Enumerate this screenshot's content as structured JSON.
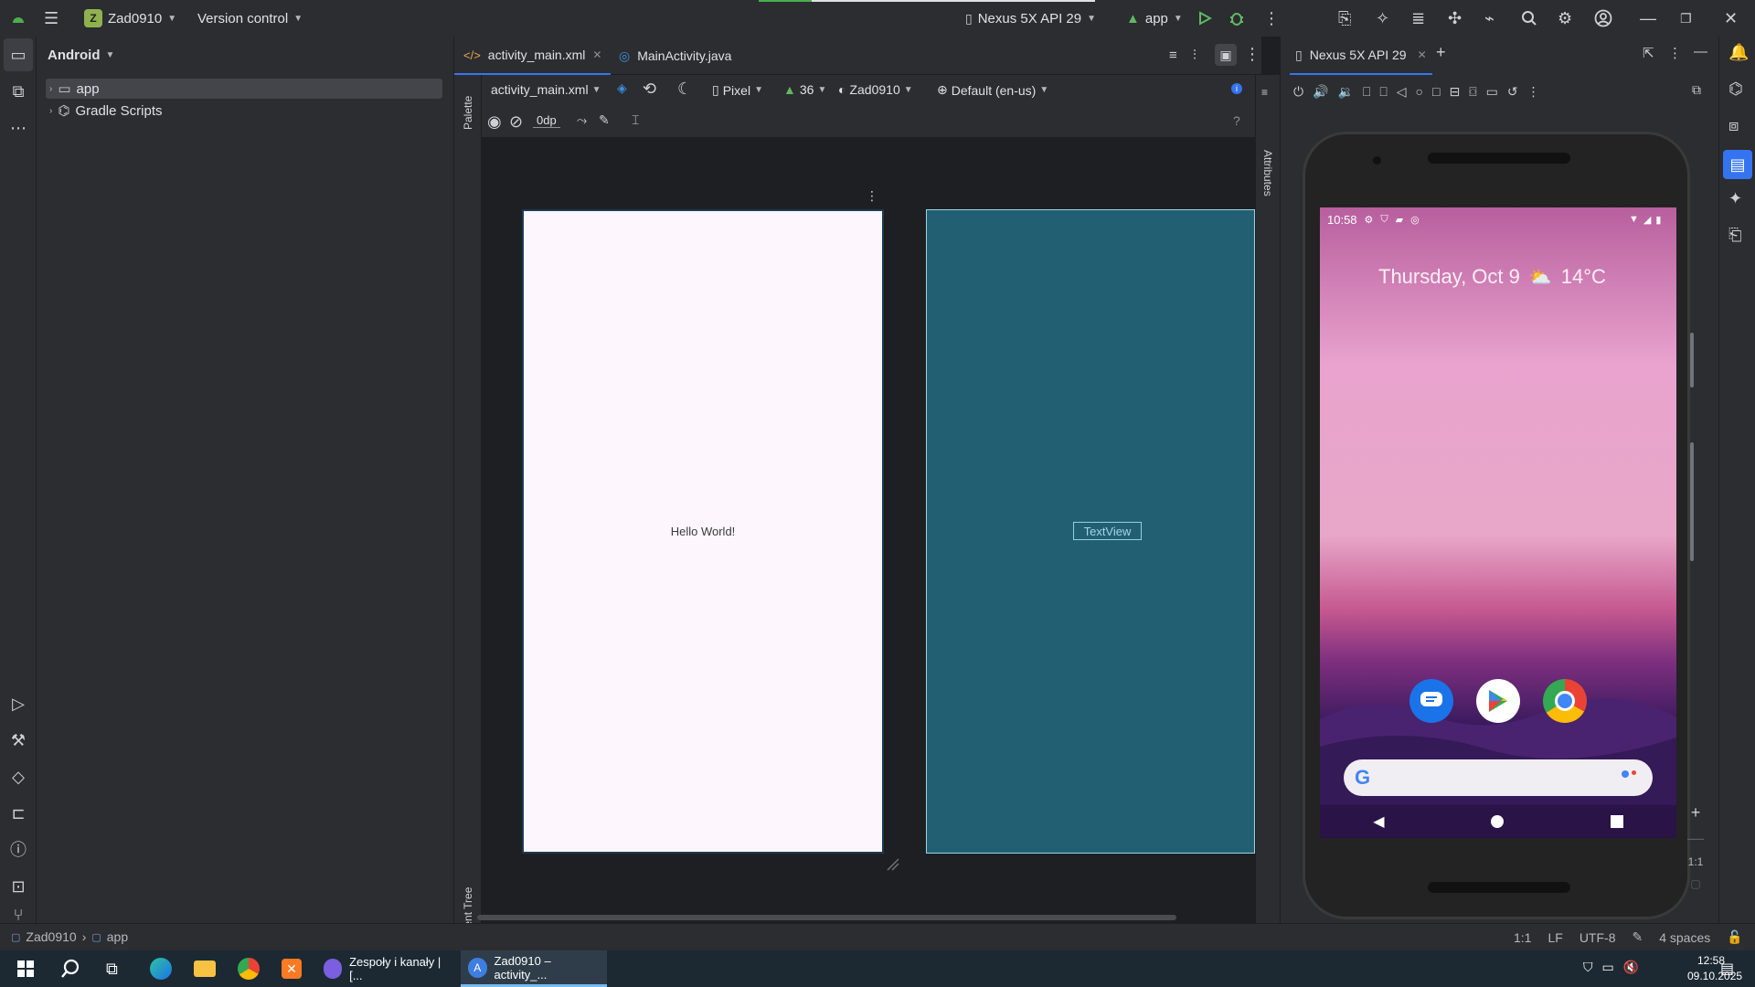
{
  "titlebar": {
    "project_badge": "Z",
    "project_name": "Zad0910",
    "vcs_label": "Version control",
    "device_selector": "Nexus 5X API 29",
    "run_config": "app"
  },
  "project_panel": {
    "view_label": "Android",
    "tree": [
      {
        "label": "app"
      },
      {
        "label": "Gradle Scripts"
      }
    ]
  },
  "editor": {
    "tabs": [
      {
        "label": "activity_main.xml"
      },
      {
        "label": "MainActivity.java"
      }
    ],
    "design_toolbar": {
      "file": "activity_main.xml",
      "device": "Pixel",
      "api": "36",
      "theme": "Zad0910",
      "locale": "Default (en-us)",
      "margin": "0dp"
    },
    "side_labels": {
      "palette": "Palette",
      "component_tree": "Component Tree",
      "attributes": "Attributes"
    },
    "design_preview_text": "Hello World!",
    "blueprint_text": "TextView"
  },
  "device_panel": {
    "tab_label": "Nexus 5X API 29",
    "phone": {
      "time": "10:58",
      "date": "Thursday, Oct 9",
      "temperature": "14°C",
      "zoom_ratio": "1:1"
    }
  },
  "statusbar": {
    "breadcrumb": [
      "Zad0910",
      "app"
    ],
    "position": "1:1",
    "line_sep": "LF",
    "encoding": "UTF-8",
    "indent": "4 spaces"
  },
  "taskbar": {
    "apps": [
      {
        "label": "Zespoły i kanały | [..."
      },
      {
        "label": "Zad0910 – activity_..."
      }
    ],
    "time": "12:58",
    "date": "09.10.2025"
  },
  "colors": {
    "accent": "#3574f0",
    "blueprint": "#235f72",
    "design_surface": "#fdf7fd",
    "wallpaper_top": "#e9a3ce",
    "wallpaper_bottom": "#3a1a5e"
  }
}
